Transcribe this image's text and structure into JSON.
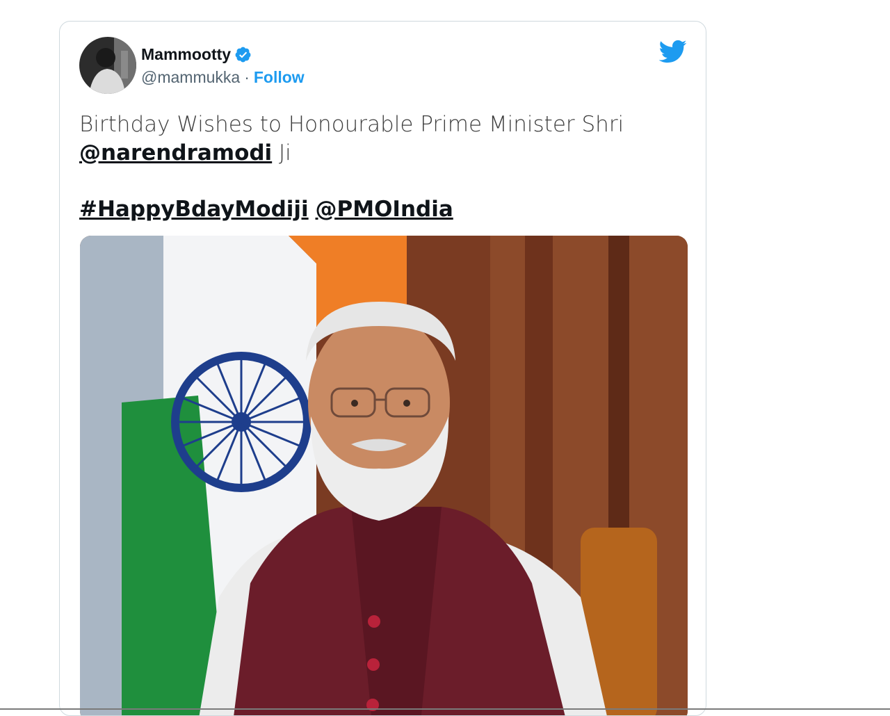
{
  "tweet": {
    "author_name": "Mammootty",
    "handle": "@mammukka",
    "separator": "·",
    "follow_label": "Follow",
    "text_line1": "Birthday Wishes to Honourable Prime Minister Shri",
    "mention_primary": "@narendramodi",
    "text_suffix": " Ji",
    "hashtag": "#HappyBdayModiji",
    "mention_secondary": "@PMOIndia",
    "icons": {
      "verified": "verified-badge-icon",
      "platform": "twitter-bird-icon"
    }
  },
  "colors": {
    "accent": "#1d9bf0",
    "text": "#0f1419",
    "muted": "#536471",
    "border": "#cfd9de"
  }
}
